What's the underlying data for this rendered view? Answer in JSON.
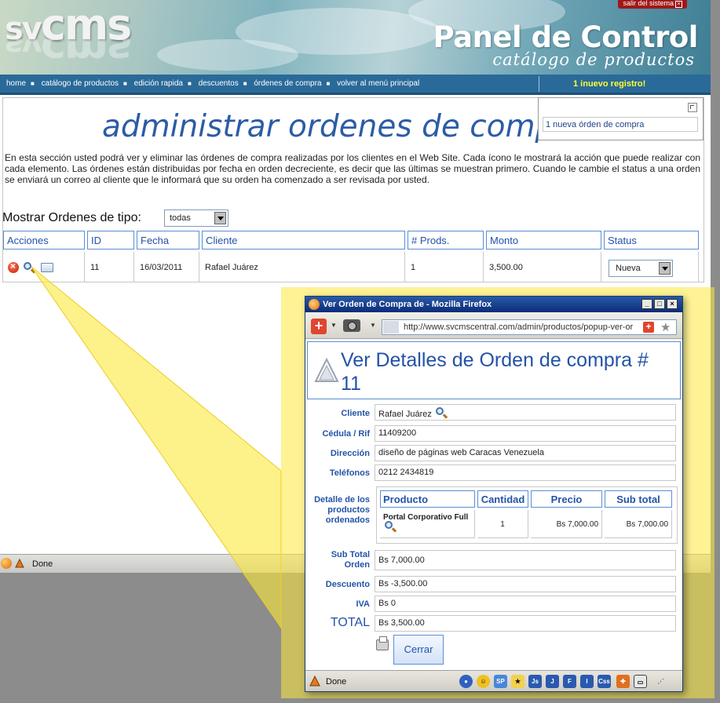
{
  "header": {
    "logo": "svcms",
    "logo_prefix": "sv",
    "logo_main": "cms",
    "title": "Panel de Control",
    "subtitle": "catálogo de productos",
    "logout_label": "salir del sistema"
  },
  "nav": {
    "items": [
      "home",
      "catálogo de productos",
      "edición rapida",
      "descuentos",
      "órdenes de compra",
      "volver al menú principal"
    ],
    "new_record": "1 inuevo registro!"
  },
  "notification": {
    "item": "1 nueva órden de compra"
  },
  "main": {
    "heading": "administrar ordenes de compra",
    "intro": "En esta sección usted podrá ver y eliminar las órdenes de compra realizadas por los clientes en el Web Site. Cada ícono le mostrará la acción que puede realizar con cada elemento. Las órdenes están distribuidas por fecha en orden decreciente, es decir que las últimas se muestran primero. Cuando le cambie el status a una orden se enviará un correo al cliente que le informará que su orden ha comenzado a ser revisada por usted.",
    "filter_label": "Mostrar Ordenes de tipo:",
    "filter_value": "todas"
  },
  "orders_table": {
    "headers": [
      "Acciones",
      "ID",
      "Fecha",
      "Cliente",
      "# Prods.",
      "Monto",
      "Status"
    ],
    "rows": [
      {
        "id": "11",
        "fecha": "16/03/2011",
        "cliente": "Rafael Juárez",
        "prods": "1",
        "monto": "3,500.00",
        "status": "Nueva"
      }
    ]
  },
  "status_bar": {
    "text": "Done"
  },
  "popup": {
    "window_title": "Ver Orden de Compra de - Mozilla Firefox",
    "url": "http://www.svcmscentral.com/admin/productos/popup-ver-or",
    "heading": "Ver Detalles de Orden de compra # 11",
    "fields": {
      "cliente_label": "Cliente",
      "cliente_value": "Rafael Juárez",
      "cedula_label": "Cédula / Rif",
      "cedula_value": "11409200",
      "direccion_label": "Dirección",
      "direccion_value": "diseño de páginas web Caracas Venezuela",
      "telefonos_label": "Teléfonos",
      "telefonos_value": "0212 2434819",
      "detalle_label": "Detalle de los productos ordenados",
      "subtotal_label": "Sub Total Orden",
      "subtotal_value": "Bs 7,000.00",
      "descuento_label": "Descuento",
      "descuento_value": "Bs -3,500.00",
      "iva_label": "IVA",
      "iva_value": "Bs 0",
      "total_label": "TOTAL",
      "total_value": "Bs 3,500.00"
    },
    "products": {
      "headers": [
        "Producto",
        "Cantidad",
        "Precio",
        "Sub total"
      ],
      "rows": [
        {
          "producto": "Portal Corporativo Full",
          "cantidad": "1",
          "precio": "Bs 7,000.00",
          "subtotal": "Bs 7,000.00"
        }
      ]
    },
    "close_label": "Cerrar",
    "status_text": "Done",
    "status_icons": [
      "SP",
      "Js",
      "J",
      "F",
      "I",
      "Css"
    ]
  },
  "colors": {
    "accent": "#2353a8",
    "nav_bg": "#2a6a99",
    "highlight": "#fce83c",
    "new_record": "#ffff33"
  }
}
